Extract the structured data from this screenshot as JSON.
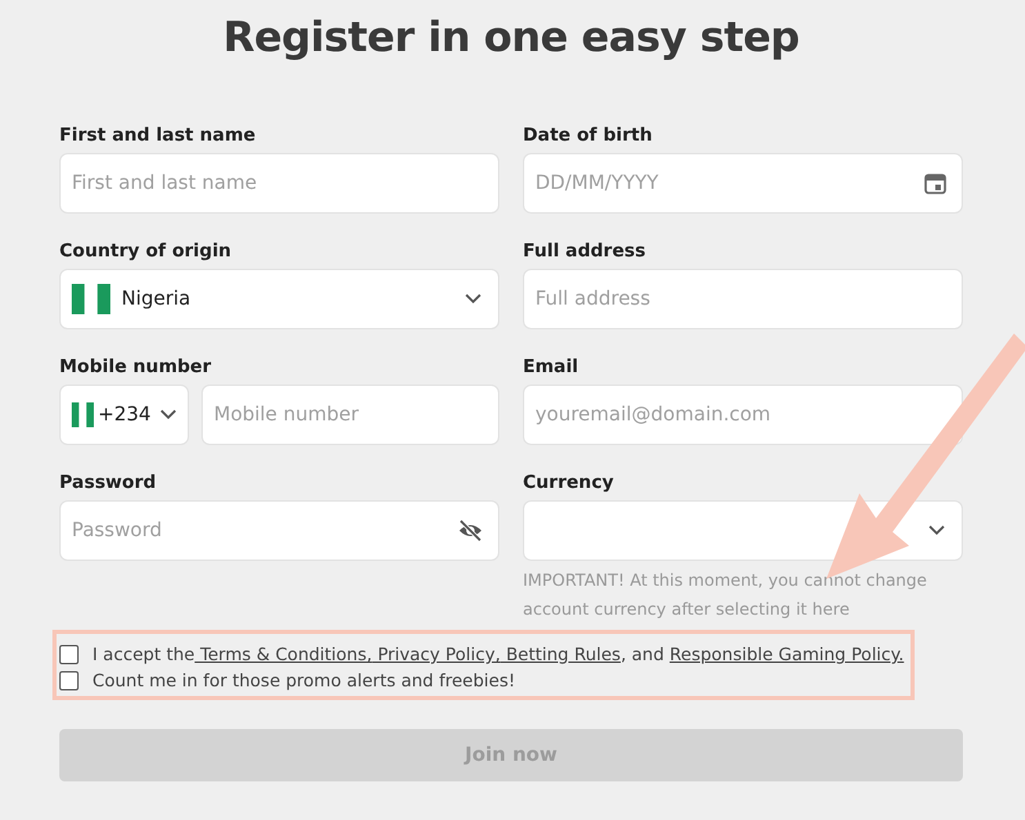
{
  "title": "Register in one easy step",
  "fields": [
    {
      "kind": "text",
      "label": "First and last name",
      "placeholder": "First and last name"
    },
    {
      "kind": "date",
      "label": "Date of birth",
      "placeholder": "DD/MM/YYYY"
    },
    {
      "kind": "country",
      "label": "Country of origin",
      "value": "Nigeria"
    },
    {
      "kind": "text",
      "label": "Full address",
      "placeholder": "Full address"
    },
    {
      "kind": "phone",
      "label": "Mobile number",
      "code": "+234",
      "placeholder": "Mobile number"
    },
    {
      "kind": "text",
      "label": "Email",
      "placeholder": "youremail@domain.com"
    },
    {
      "kind": "password",
      "label": "Password",
      "placeholder": "Password"
    },
    {
      "kind": "select",
      "label": "Currency",
      "note": "IMPORTANT! At this moment, you cannot change account currency after selecting it here"
    }
  ],
  "consents": [
    {
      "checked": false,
      "parts": [
        {
          "kind": "text",
          "text": "I accept the"
        },
        {
          "kind": "link",
          "text": " Terms & Conditions,"
        },
        {
          "kind": "link",
          "text": " Privacy Policy,"
        },
        {
          "kind": "link",
          "text": " Betting Rules"
        },
        {
          "kind": "text",
          "text": ", and "
        },
        {
          "kind": "link",
          "text": "Responsible Gaming Policy."
        }
      ]
    },
    {
      "checked": false,
      "parts": [
        {
          "kind": "text",
          "text": "Count me in for those promo alerts and freebies!"
        }
      ]
    }
  ],
  "submit": {
    "label": "Join now",
    "disabled": true
  }
}
